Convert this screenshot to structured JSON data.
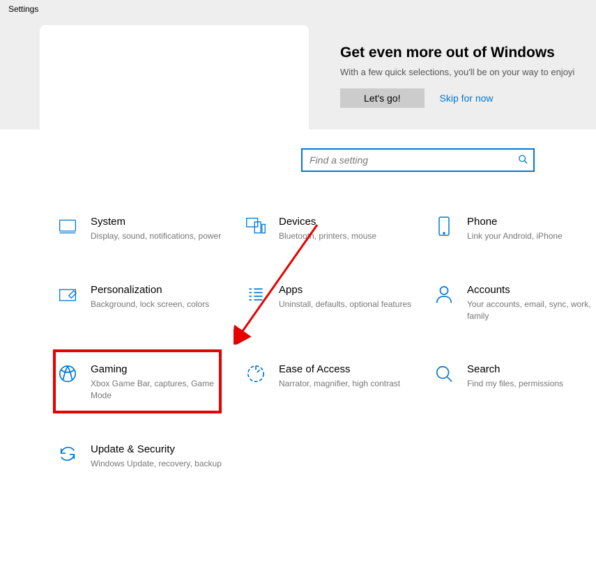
{
  "window": {
    "title": "Settings"
  },
  "promo": {
    "title": "Get even more out of Windows",
    "subtitle": "With a few quick selections, you'll be on your way to enjoyi",
    "cta": "Let's go!",
    "skip": "Skip for now"
  },
  "search": {
    "placeholder": "Find a setting"
  },
  "tiles": {
    "system": {
      "title": "System",
      "desc": "Display, sound, notifications, power"
    },
    "devices": {
      "title": "Devices",
      "desc": "Bluetooth, printers, mouse"
    },
    "phone": {
      "title": "Phone",
      "desc": "Link your Android, iPhone"
    },
    "personal": {
      "title": "Personalization",
      "desc": "Background, lock screen, colors"
    },
    "apps": {
      "title": "Apps",
      "desc": "Uninstall, defaults, optional features"
    },
    "accounts": {
      "title": "Accounts",
      "desc": "Your accounts, email, sync, work, family"
    },
    "gaming": {
      "title": "Gaming",
      "desc": "Xbox Game Bar, captures, Game Mode"
    },
    "ease": {
      "title": "Ease of Access",
      "desc": "Narrator, magnifier, high contrast"
    },
    "search": {
      "title": "Search",
      "desc": "Find my files, permissions"
    },
    "update": {
      "title": "Update & Security",
      "desc": "Windows Update, recovery, backup"
    }
  }
}
